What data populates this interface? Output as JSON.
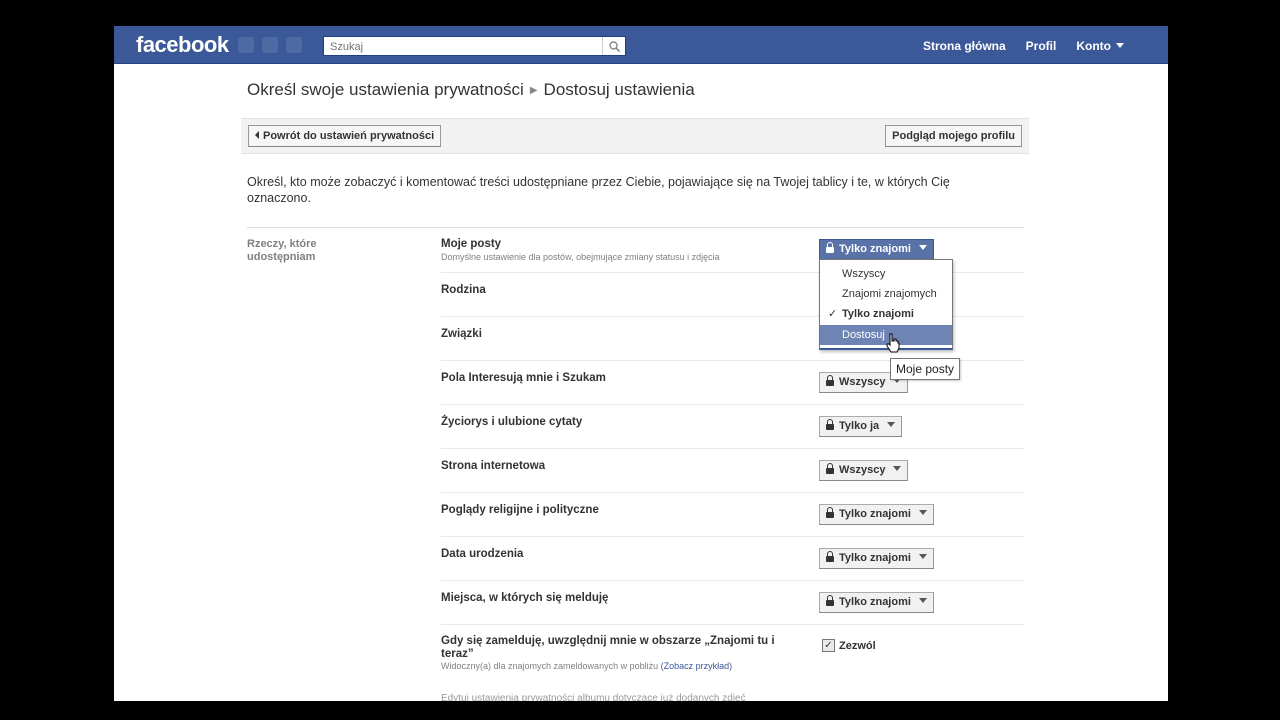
{
  "topbar": {
    "logo": "facebook",
    "search_placeholder": "Szukaj",
    "nav": [
      "Strona główna",
      "Profil",
      "Konto"
    ]
  },
  "breadcrumb": {
    "part1": "Określ swoje ustawienia prywatności",
    "part2": "Dostosuj ustawienia"
  },
  "toolbar": {
    "back_label": "Powrót do ustawień prywatności",
    "preview_label": "Podgląd mojego profilu"
  },
  "description": "Określ, kto może zobaczyć i komentować treści udostępniane przez Ciebie, pojawiające się na Twojej tablicy i te, w których Cię oznaczono.",
  "section_label": "Rzeczy, które udostępniam",
  "rows": [
    {
      "title": "Moje posty",
      "subtitle": "Domyślne ustawienie dla postów, obejmujące zmiany statusu i zdjęcia",
      "value": "Tylko znajomi"
    },
    {
      "title": "Rodzina",
      "value": ""
    },
    {
      "title": "Związki",
      "value": ""
    },
    {
      "title": "Pola Interesują mnie i Szukam",
      "value": "Wszyscy"
    },
    {
      "title": "Życiorys i ulubione cytaty",
      "value": "Tylko ja"
    },
    {
      "title": "Strona internetowa",
      "value": "Wszyscy"
    },
    {
      "title": "Poglądy religijne i polityczne",
      "value": "Tylko znajomi"
    },
    {
      "title": "Data urodzenia",
      "value": "Tylko znajomi"
    },
    {
      "title": "Miejsca, w których się melduję",
      "value": "Tylko znajomi"
    },
    {
      "title": "Gdy się zamelduję, uwzględnij mnie w obszarze „Znajomi tu i teraz”",
      "subtitle": "Widoczny(a) dla znajomych zameldowanych w pobliżu",
      "link": "(Zobacz przykład)",
      "value": ""
    }
  ],
  "dropdown": {
    "options": [
      "Wszyscy",
      "Znajomi znajomych",
      "Tylko znajomi",
      "Dostosuj"
    ],
    "checked": "Tylko znajomi",
    "hovered": "Dostosuj"
  },
  "tooltip": "Moje posty",
  "checkbox": {
    "label": "Zezwól",
    "checked": true
  },
  "cutoff_text": "Edytuj ustawienia prywatności albumu dotyczące już dodanych zdjęć",
  "colors": {
    "brand": "#3b5998",
    "hover": "#6d84b4"
  }
}
